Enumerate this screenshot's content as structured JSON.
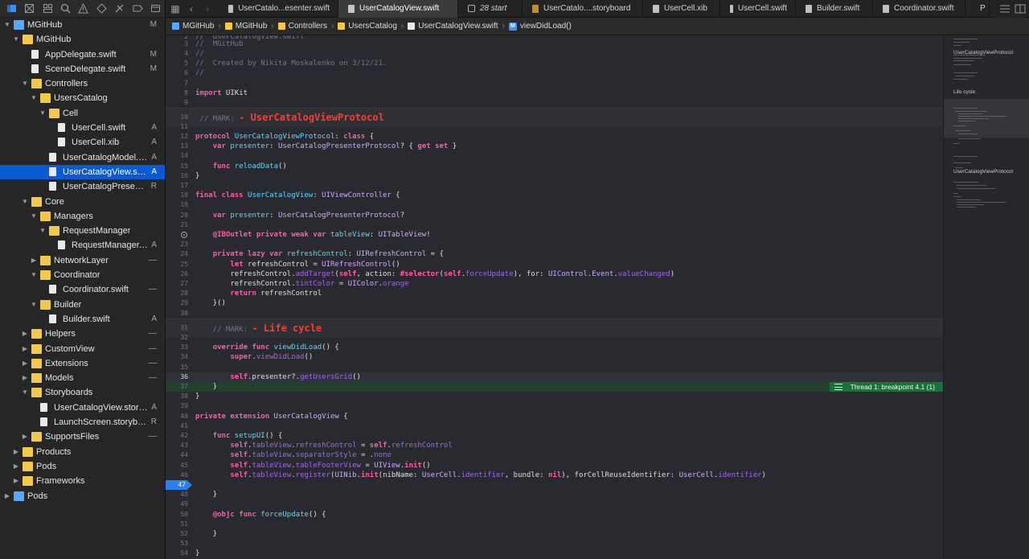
{
  "navigator": {
    "tree": [
      {
        "label": "MGitHub",
        "status": "M",
        "depth": 0,
        "kind": "project",
        "expanded": true
      },
      {
        "label": "MGitHub",
        "status": "",
        "depth": 1,
        "kind": "folder",
        "expanded": true
      },
      {
        "label": "AppDelegate.swift",
        "status": "M",
        "depth": 2,
        "kind": "file"
      },
      {
        "label": "SceneDelegate.swift",
        "status": "M",
        "depth": 2,
        "kind": "file"
      },
      {
        "label": "Controllers",
        "status": "",
        "depth": 2,
        "kind": "folder",
        "expanded": true
      },
      {
        "label": "UsersCatalog",
        "status": "",
        "depth": 3,
        "kind": "folder",
        "expanded": true
      },
      {
        "label": "Cell",
        "status": "",
        "depth": 4,
        "kind": "folder",
        "expanded": true
      },
      {
        "label": "UserCell.swift",
        "status": "A",
        "depth": 5,
        "kind": "file"
      },
      {
        "label": "UserCell.xib",
        "status": "A",
        "depth": 5,
        "kind": "file"
      },
      {
        "label": "UserCatalogModel.sw...",
        "status": "A",
        "depth": 4,
        "kind": "file"
      },
      {
        "label": "UserCatalogView.swift",
        "status": "A",
        "depth": 4,
        "kind": "file",
        "selected": true
      },
      {
        "label": "UserCatalogPresenter...",
        "status": "R",
        "depth": 4,
        "kind": "file"
      },
      {
        "label": "Core",
        "status": "",
        "depth": 2,
        "kind": "folder",
        "expanded": true
      },
      {
        "label": "Managers",
        "status": "",
        "depth": 3,
        "kind": "folder",
        "expanded": true
      },
      {
        "label": "RequestManager",
        "status": "",
        "depth": 4,
        "kind": "folder",
        "expanded": true
      },
      {
        "label": "RequestManager.s...",
        "status": "A",
        "depth": 5,
        "kind": "file"
      },
      {
        "label": "NetworkLayer",
        "status": "—",
        "depth": 3,
        "kind": "folder",
        "expanded": false
      },
      {
        "label": "Coordinator",
        "status": "",
        "depth": 3,
        "kind": "folder",
        "expanded": true
      },
      {
        "label": "Coordinator.swift",
        "status": "—",
        "depth": 4,
        "kind": "file"
      },
      {
        "label": "Builder",
        "status": "",
        "depth": 3,
        "kind": "folder",
        "expanded": true
      },
      {
        "label": "Builder.swift",
        "status": "A",
        "depth": 4,
        "kind": "file"
      },
      {
        "label": "Helpers",
        "status": "—",
        "depth": 2,
        "kind": "folder",
        "expanded": false
      },
      {
        "label": "CustomView",
        "status": "—",
        "depth": 2,
        "kind": "folder",
        "expanded": false
      },
      {
        "label": "Extensions",
        "status": "—",
        "depth": 2,
        "kind": "folder",
        "expanded": false
      },
      {
        "label": "Models",
        "status": "—",
        "depth": 2,
        "kind": "folder",
        "expanded": false
      },
      {
        "label": "Storyboards",
        "status": "",
        "depth": 2,
        "kind": "folder",
        "expanded": true
      },
      {
        "label": "UserCatalogView.storyb...",
        "status": "A",
        "depth": 3,
        "kind": "file"
      },
      {
        "label": "LaunchScreen.storyboard",
        "status": "R",
        "depth": 3,
        "kind": "file"
      },
      {
        "label": "SupportsFiles",
        "status": "—",
        "depth": 2,
        "kind": "folder",
        "expanded": false
      },
      {
        "label": "Products",
        "status": "",
        "depth": 1,
        "kind": "folder",
        "expanded": false
      },
      {
        "label": "Pods",
        "status": "",
        "depth": 1,
        "kind": "folder",
        "expanded": false
      },
      {
        "label": "Frameworks",
        "status": "",
        "depth": 1,
        "kind": "folder",
        "expanded": false
      },
      {
        "label": "Pods",
        "status": "",
        "depth": 0,
        "kind": "project",
        "expanded": false
      }
    ]
  },
  "tabs": [
    {
      "label": "UserCatalo...esenter.swift",
      "icon": "file",
      "active": false
    },
    {
      "label": "UserCatalogView.swift",
      "icon": "file",
      "active": true
    },
    {
      "label": "28 start",
      "icon": "terminal",
      "active": false,
      "italic": true
    },
    {
      "label": "UserCatalo....storyboard",
      "icon": "storyboard",
      "active": false
    },
    {
      "label": "UserCell.xib",
      "icon": "file",
      "active": false
    },
    {
      "label": "UserCell.swift",
      "icon": "file",
      "active": false
    },
    {
      "label": "Builder.swift",
      "icon": "file",
      "active": false
    },
    {
      "label": "Coordinator.swift",
      "icon": "file",
      "active": false
    },
    {
      "label": "P",
      "icon": "file",
      "active": false
    }
  ],
  "jumpbar": {
    "crumbs": [
      "MGitHub",
      "MGitHub",
      "Controllers",
      "UsersCatalog",
      "UserCatalogView.swift",
      "viewDidLoad()"
    ],
    "method_badge": "M"
  },
  "debug": {
    "breakpoint_label": "Thread 1: breakpoint 4.1 (1)",
    "current_line": "47"
  },
  "minimap": {
    "labels": [
      "UserCatalogViewProtocol",
      "Life cycle",
      "UserCatalogViewProtocol"
    ]
  },
  "colors": {
    "keyword": "#fc5fa3",
    "type": "#5dd8ff",
    "comment": "#6c7986",
    "mark": "#ff3a30",
    "selection": "#0a5ad6",
    "breakpoint": "#1f6f3a"
  }
}
